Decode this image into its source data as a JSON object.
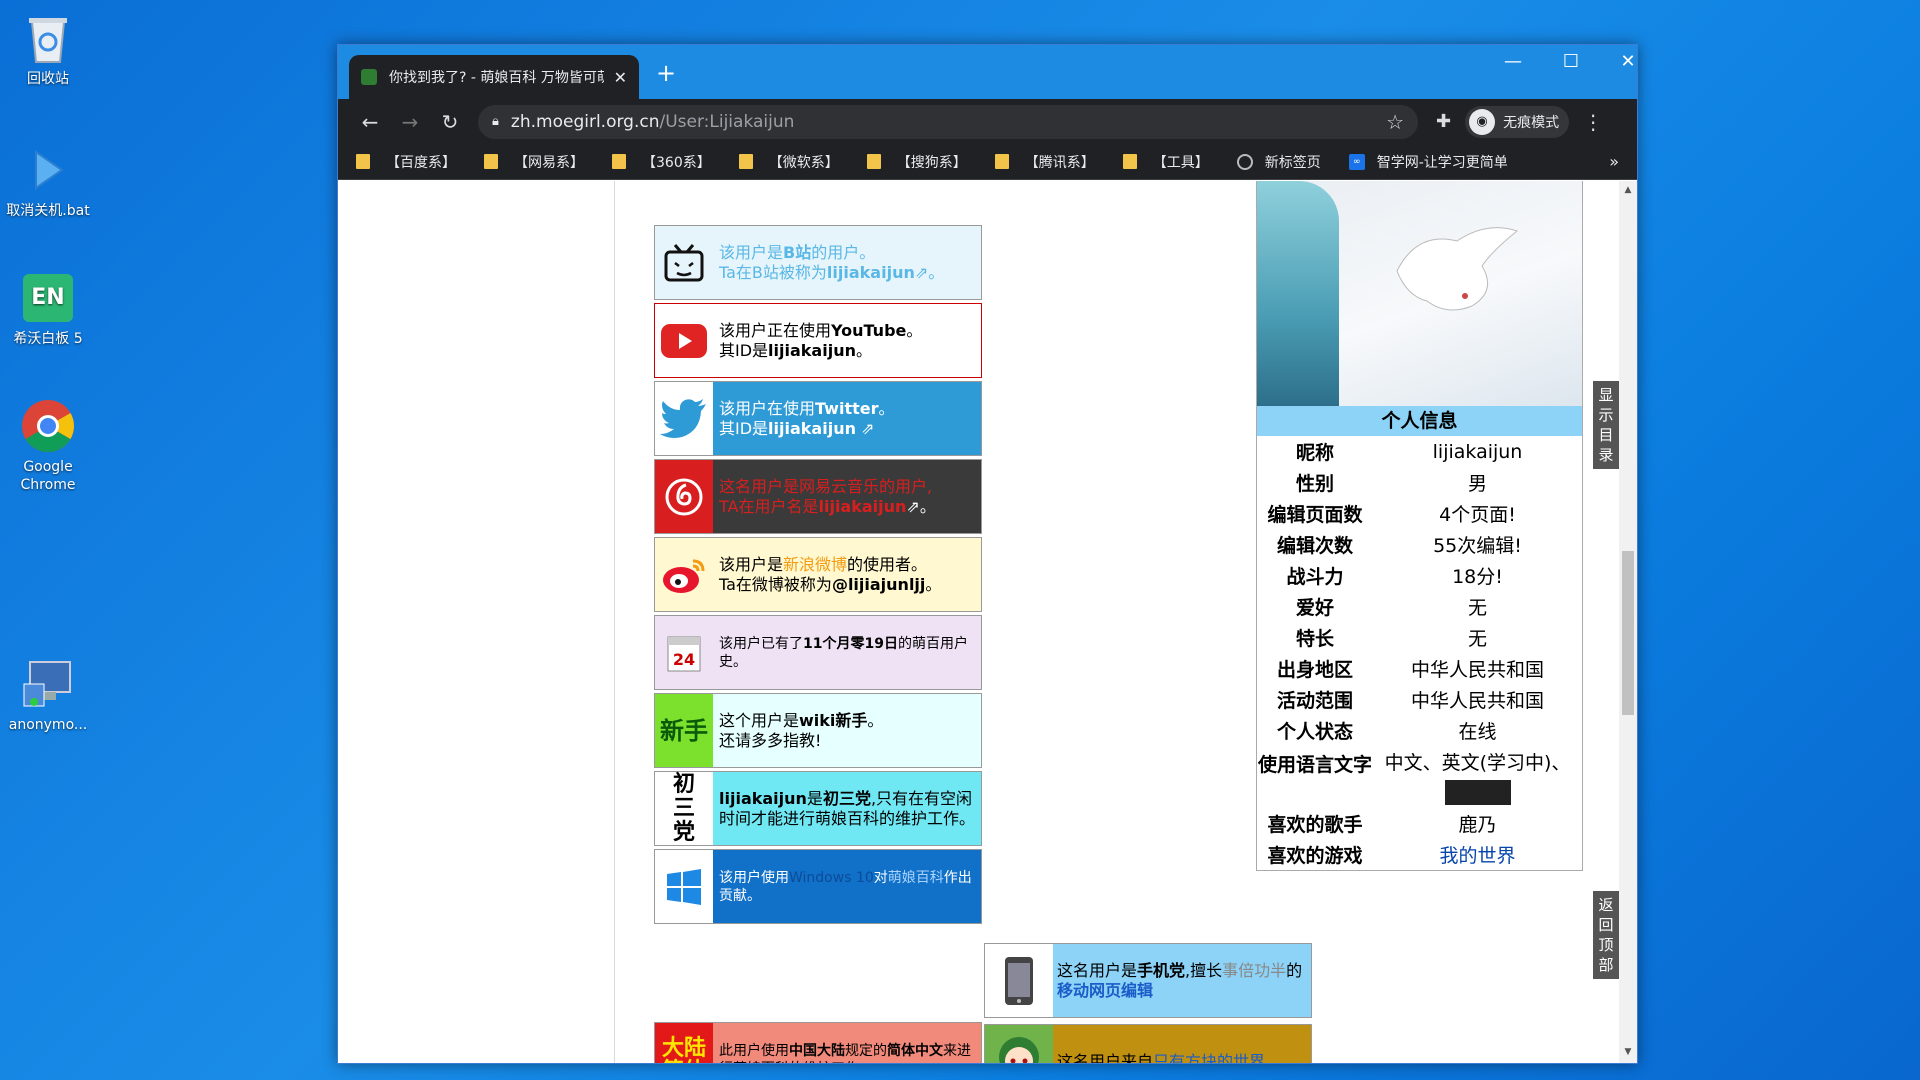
{
  "desktop": {
    "icons": [
      {
        "label": "回收站"
      },
      {
        "label": "取消关机.bat"
      },
      {
        "label": "希沃白板 5",
        "badge": "EN"
      },
      {
        "label": "Google Chrome"
      },
      {
        "label": "anonymo..."
      }
    ]
  },
  "browser": {
    "tab_title": "你找到我了? - 萌娘百科 万物皆可萌",
    "url_host": "zh.moegirl.org.cn",
    "url_path": "/User:Lijiakaijun",
    "incognito_label": "无痕模式",
    "bookmarks": [
      {
        "label": "【百度系】",
        "type": "folder"
      },
      {
        "label": "【网易系】",
        "type": "folder"
      },
      {
        "label": "【360系】",
        "type": "folder"
      },
      {
        "label": "【微软系】",
        "type": "folder"
      },
      {
        "label": "【搜狗系】",
        "type": "folder"
      },
      {
        "label": "【腾讯系】",
        "type": "folder"
      },
      {
        "label": "【工具】",
        "type": "folder"
      },
      {
        "label": "新标签页",
        "type": "page"
      },
      {
        "label": "智学网-让学习更简单",
        "type": "page"
      }
    ]
  },
  "userboxes": {
    "bilibili": {
      "line1a": "该用户是",
      "line1b": "B站",
      "line1c": "的用户。",
      "line2a": "Ta在B站被称为",
      "line2b": "lijiakaijun",
      "color": "#e6f4fb"
    },
    "youtube": {
      "line1a": "该用户正在使用",
      "line1b": "YouTube",
      "line1c": "。",
      "line2a": "其ID是",
      "line2b": "lijiakaijun",
      "line2c": "。"
    },
    "twitter": {
      "line1a": "该用户在使用",
      "line1b": "Twitter",
      "line1c": "。",
      "line2a": "其ID是",
      "line2b": "lijiakaijun"
    },
    "netease": {
      "line1": "这名用户是网易云音乐的用户,",
      "line2a": "TA在用户名是",
      "line2b": "lijiakaijun"
    },
    "weibo": {
      "line1a": "该用户是",
      "line1b": "新浪微博",
      "line1c": "的使用者。",
      "line2a": "Ta在微博被称为",
      "line2b": "@lijiajunljj",
      "line2c": "。"
    },
    "age": {
      "text_a": "该用户已有了",
      "text_b": "11个月零19日",
      "text_c": "的萌百用户史。",
      "calendar_day": "24"
    },
    "newbie": {
      "icon": "新手",
      "line1a": "这个用户是",
      "line1b": "wiki新手",
      "line1c": "。",
      "line2": "还请多多指教!"
    },
    "junior": {
      "icon": "初三党",
      "name": "lijiakaijun",
      "text_a": "是",
      "text_b": "初三党",
      "text_c": ",只有在有空闲时间才能进行萌娘百科的维护工作。"
    },
    "windows": {
      "text_a": "该用户使用",
      "text_b": "Windows 10",
      "text_c": "对",
      "text_d": "萌娘百科",
      "text_e": "作出贡献。"
    },
    "mainland": {
      "icon": "大陆简体",
      "text_a": "此用户使用",
      "text_b": "中国大陆",
      "text_c": "规定的",
      "text_d": "简体中文",
      "text_e": "来进行萌娘百科的维护工作。"
    },
    "phone": {
      "text_a": "这名用户是",
      "text_b": "手机党",
      "text_c": ",擅长",
      "text_d": "事倍功半",
      "text_e": "的",
      "text_f": "移动网页编辑"
    },
    "minecraft": {
      "text_a": "这名用户来自",
      "text_b": "只有方块的世界"
    }
  },
  "info": {
    "header": "个人信息",
    "rows": [
      {
        "k": "昵称",
        "v": "lijiakaijun"
      },
      {
        "k": "性别",
        "v": "男"
      },
      {
        "k": "编辑页面数",
        "v": "4个页面!"
      },
      {
        "k": "编辑次数",
        "v": "55次编辑!"
      },
      {
        "k": "战斗力",
        "v": "18分!"
      },
      {
        "k": "爱好",
        "v": "无"
      },
      {
        "k": "特长",
        "v": "无"
      },
      {
        "k": "出身地区",
        "v": "中华人民共和国"
      },
      {
        "k": "活动范围",
        "v": "中华人民共和国"
      },
      {
        "k": "个人状态",
        "v": "在线"
      },
      {
        "k": "使用语言文字",
        "v": "中文、英文(学习中)、"
      },
      {
        "k": "喜欢的歌手",
        "v": "鹿乃"
      },
      {
        "k": "喜欢的游戏",
        "v": "我的世界"
      }
    ]
  },
  "side_buttons": {
    "toc": "显示目录",
    "top": "返回顶部"
  }
}
